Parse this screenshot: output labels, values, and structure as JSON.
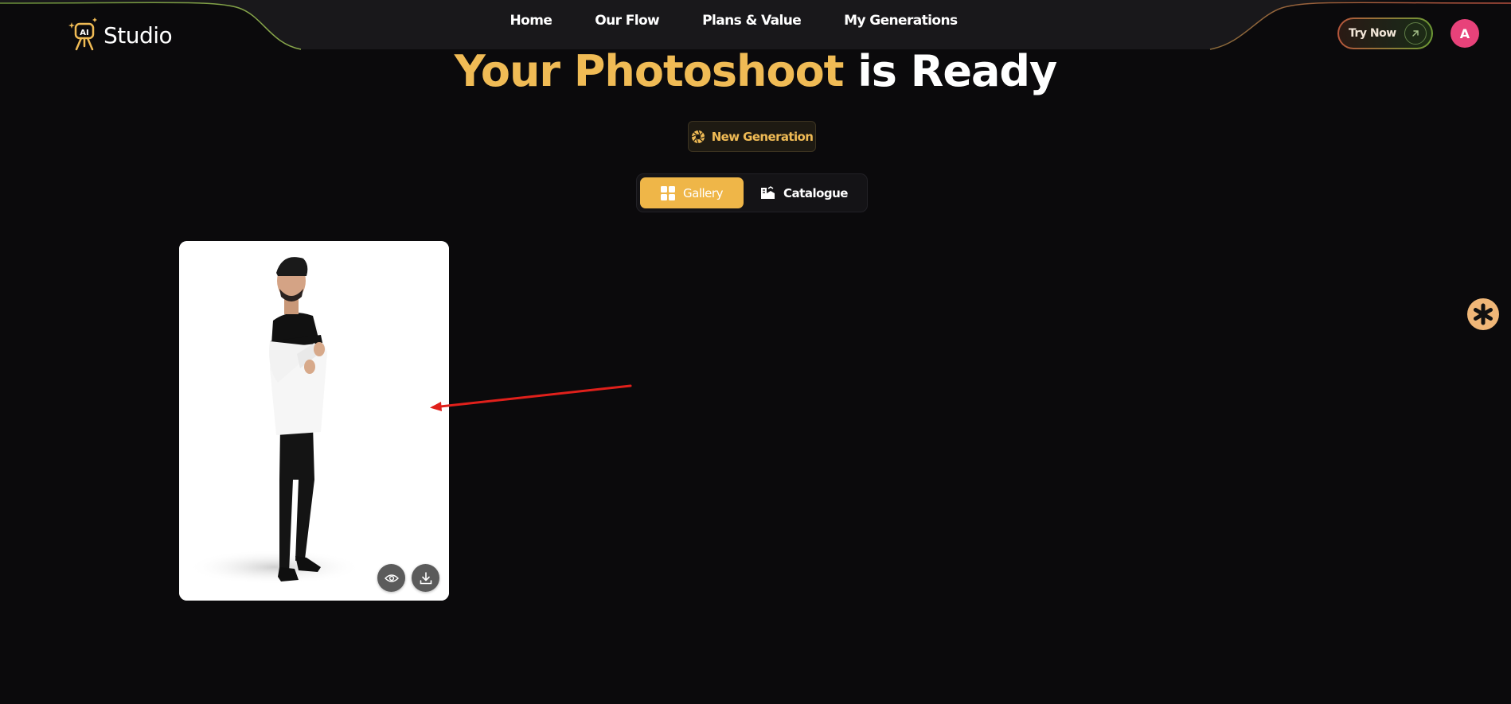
{
  "brand": {
    "name": "Studio",
    "logo_badge": "AI",
    "logo_icon": "ai-studio-logo-icon"
  },
  "nav": {
    "items": [
      {
        "label": "Home"
      },
      {
        "label": "Our Flow"
      },
      {
        "label": "Plans & Value"
      },
      {
        "label": "My Generations"
      }
    ]
  },
  "header": {
    "try_now_label": "Try Now",
    "try_now_icon": "arrow-up-right-icon",
    "avatar_initial": "A"
  },
  "hero": {
    "title_accent": "Your Photoshoot",
    "title_plain": "is Ready",
    "new_generation_label": "New Generation",
    "new_generation_icon": "aperture-icon"
  },
  "view_tabs": [
    {
      "label": "Gallery",
      "icon": "grid-icon",
      "active": true
    },
    {
      "label": "Catalogue",
      "icon": "catalogue-icon",
      "active": false
    }
  ],
  "gallery": {
    "items": [
      {
        "actions": [
          "eye-icon",
          "download-icon"
        ]
      }
    ]
  },
  "support_widget": {
    "icon": "asterisk-icon"
  },
  "colors": {
    "background": "#0b0a0c",
    "accent": "#f0bb55",
    "tab_active": "#efb648",
    "avatar": "#e8427a",
    "annotation_arrow": "#e0201b"
  }
}
